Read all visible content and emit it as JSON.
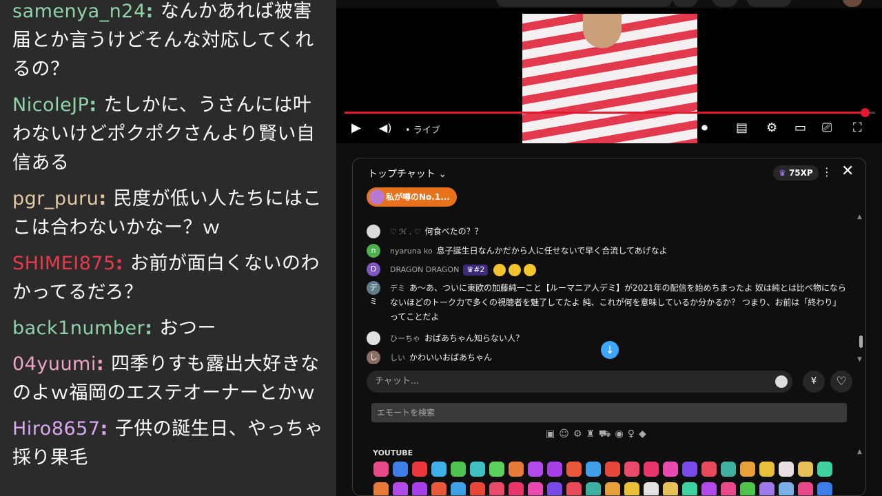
{
  "left_chat": [
    {
      "user": "samenya_n24",
      "user_color": "#8fd4a8",
      "text": "なんかあれば被害届とか言うけどそんな対応してくれるの？"
    },
    {
      "user": "NicoleJP",
      "user_color": "#8fd4a8",
      "text": "たしかに、うさんには叶わないけどポクポクさんより賢い自信ある"
    },
    {
      "user": "pgr_puru",
      "user_color": "#e3c9a0",
      "text": "民度が低い人たちにはここは合わないかなー？ｗ"
    },
    {
      "user": "SHIMEI875",
      "user_color": "#e83a4a",
      "text": "お前が面白くないのわかってるだろ？"
    },
    {
      "user": "back1number",
      "user_color": "#8fd4a8",
      "text": "おつー"
    },
    {
      "user": "04yuumi",
      "user_color": "#f0a3c8",
      "text": "四季りすも露出大好きなのよｗ福岡のエステオーナーとかｗ"
    },
    {
      "user": "Hiro8657",
      "user_color": "#d8a8f0",
      "text": "子供の誕生日、やっちゃ採り果毛"
    }
  ],
  "player": {
    "live_label": "• ライブ",
    "progress": 0.98
  },
  "chat": {
    "title": "トップチャット",
    "xp": "75XP",
    "pinned": "私が噂のNo.1...",
    "messages": [
      {
        "avatar": "",
        "avatar_color": "#d9d9d9",
        "name": "♡ ℋ . ♡",
        "badge": "",
        "text": "何食べたの？？"
      },
      {
        "avatar": "n",
        "avatar_color": "#4caf50",
        "name": "nyaruna ko",
        "badge": "",
        "text": "息子誕生日なんかだから人に任せないで早く合流してあげなよ"
      },
      {
        "avatar": "D",
        "avatar_color": "#7e57c2",
        "name": "DRAGON DRAGON",
        "badge": "♛#2",
        "text": ""
      },
      {
        "avatar": "デミ",
        "avatar_color": "#607d8b",
        "name": "デミ",
        "badge": "",
        "text": "あ〜あ、ついに東欧の加藤純一こと【ルーマニア人デミ】が2021年の配信を始めちまったよ 奴は純とは比べ物にならないほどのトーク力で多くの視聴者を魅了してたよ 純、これが何を意味しているか分かるか？ つまり、お前は「終わり」ってことだよ"
      },
      {
        "avatar": "",
        "avatar_color": "#e0e0e0",
        "name": "ひーちゃ",
        "badge": "",
        "text": "おばあちゃん知らない人？"
      },
      {
        "avatar": "しい",
        "avatar_color": "#8d6e63",
        "name": "しい",
        "badge": "",
        "text": "かわいいおばあちゃん"
      }
    ],
    "input_placeholder": "チャット...",
    "yen_label": "¥",
    "emote_search_placeholder": "エモートを検索",
    "youtube_label": "YOUTUBE",
    "emote_cats": "▣☺⚙♜⛟◉♀◆"
  }
}
